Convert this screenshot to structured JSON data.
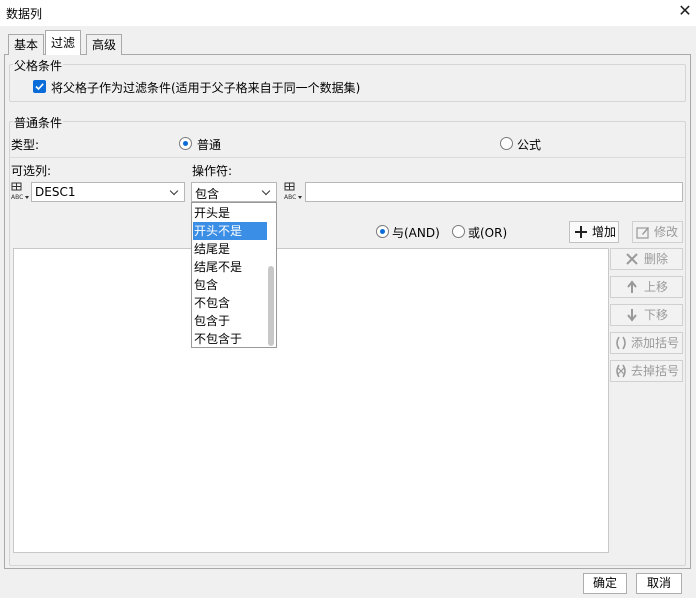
{
  "window": {
    "title": "数据列"
  },
  "tabs": [
    {
      "label": "基本"
    },
    {
      "label": "过滤"
    },
    {
      "label": "高级"
    }
  ],
  "parent_condition": {
    "title": "父格条件",
    "checkbox_label": "将父格子作为过滤条件(适用于父子格来自于同一个数据集)",
    "checked": true
  },
  "normal_condition": {
    "title": "普通条件",
    "type_label": "类型:",
    "type_options": [
      {
        "label": "普通",
        "selected": true
      },
      {
        "label": "公式",
        "selected": false
      }
    ],
    "column_label": "可选列:",
    "operator_label": "操作符:",
    "column_value": "DESC1",
    "operator_value": "包含",
    "value_input": ""
  },
  "operator_dropdown": {
    "items": [
      "开头是",
      "开头不是",
      "结尾是",
      "结尾不是",
      "包含",
      "不包含",
      "包含于",
      "不包含于"
    ],
    "selected_index": 1
  },
  "logic": {
    "and_label": "与(AND)",
    "or_label": "或(OR)",
    "and_selected": true
  },
  "buttons": {
    "add": "增加",
    "modify": "修改",
    "delete": "删除",
    "move_up": "上移",
    "move_down": "下移",
    "add_bracket": "添加括号",
    "remove_bracket": "去掉括号"
  },
  "footer": {
    "ok": "确定",
    "cancel": "取消"
  },
  "colors": {
    "accent": "#0a6cd8",
    "selection": "#3a8ee6"
  }
}
